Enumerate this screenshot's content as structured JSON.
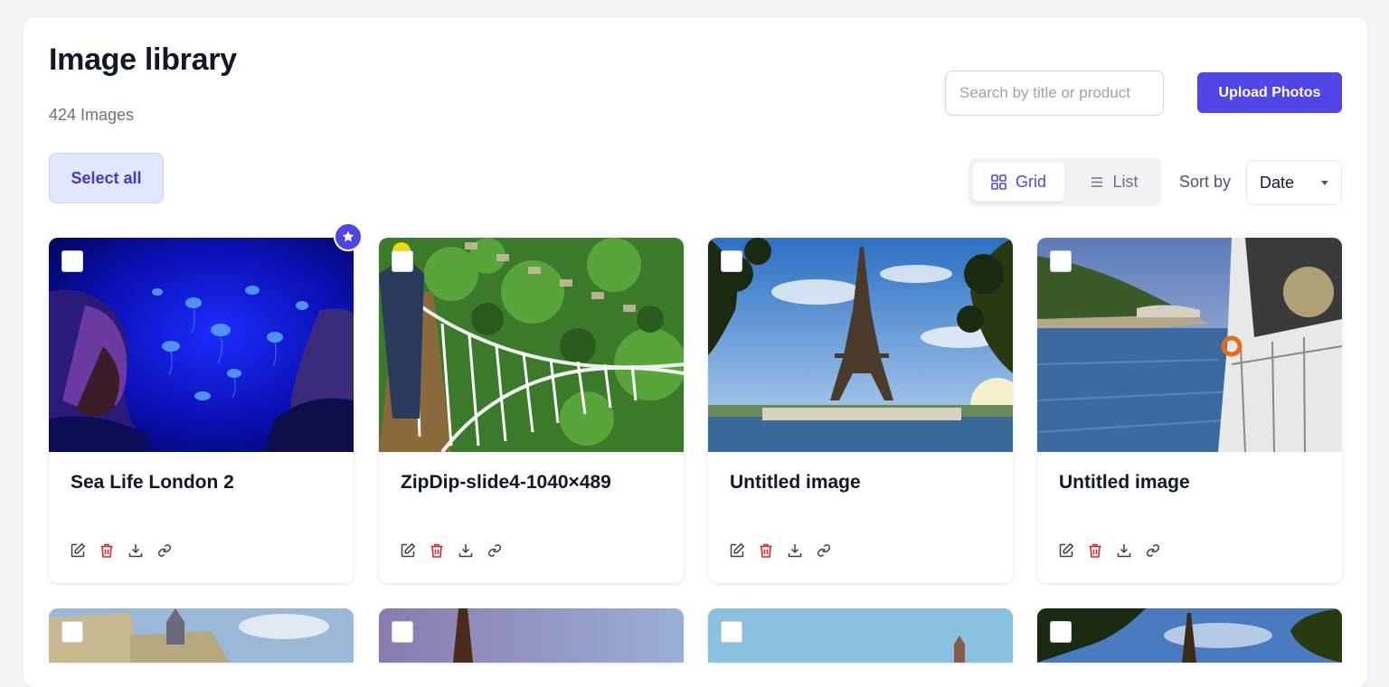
{
  "header": {
    "title": "Image library",
    "count": "424 Images"
  },
  "search": {
    "placeholder": "Search by title or product",
    "value": ""
  },
  "upload_label": "Upload Photos",
  "select_all_label": "Select all",
  "view": {
    "grid_label": "Grid",
    "list_label": "List",
    "active": "grid"
  },
  "sort": {
    "label": "Sort by",
    "value": "Date"
  },
  "colors": {
    "accent": "#4f46e5",
    "danger": "#dc2626"
  },
  "cards": [
    {
      "title": "Sea Life London 2",
      "featured": true,
      "scene": "jellyfish"
    },
    {
      "title": "ZipDip-slide4-1040×489",
      "featured": false,
      "scene": "rope-bridge"
    },
    {
      "title": "Untitled image",
      "featured": false,
      "scene": "eiffel-tower"
    },
    {
      "title": "Untitled image",
      "featured": false,
      "scene": "seine-boat"
    },
    {
      "title": "",
      "featured": false,
      "scene": "paris-building"
    },
    {
      "title": "",
      "featured": false,
      "scene": "eiffel-dusk"
    },
    {
      "title": "",
      "featured": false,
      "scene": "sky-river"
    },
    {
      "title": "",
      "featured": false,
      "scene": "eiffel-trees"
    }
  ],
  "card_actions": [
    "edit-icon",
    "trash-icon",
    "download-icon",
    "link-icon"
  ]
}
